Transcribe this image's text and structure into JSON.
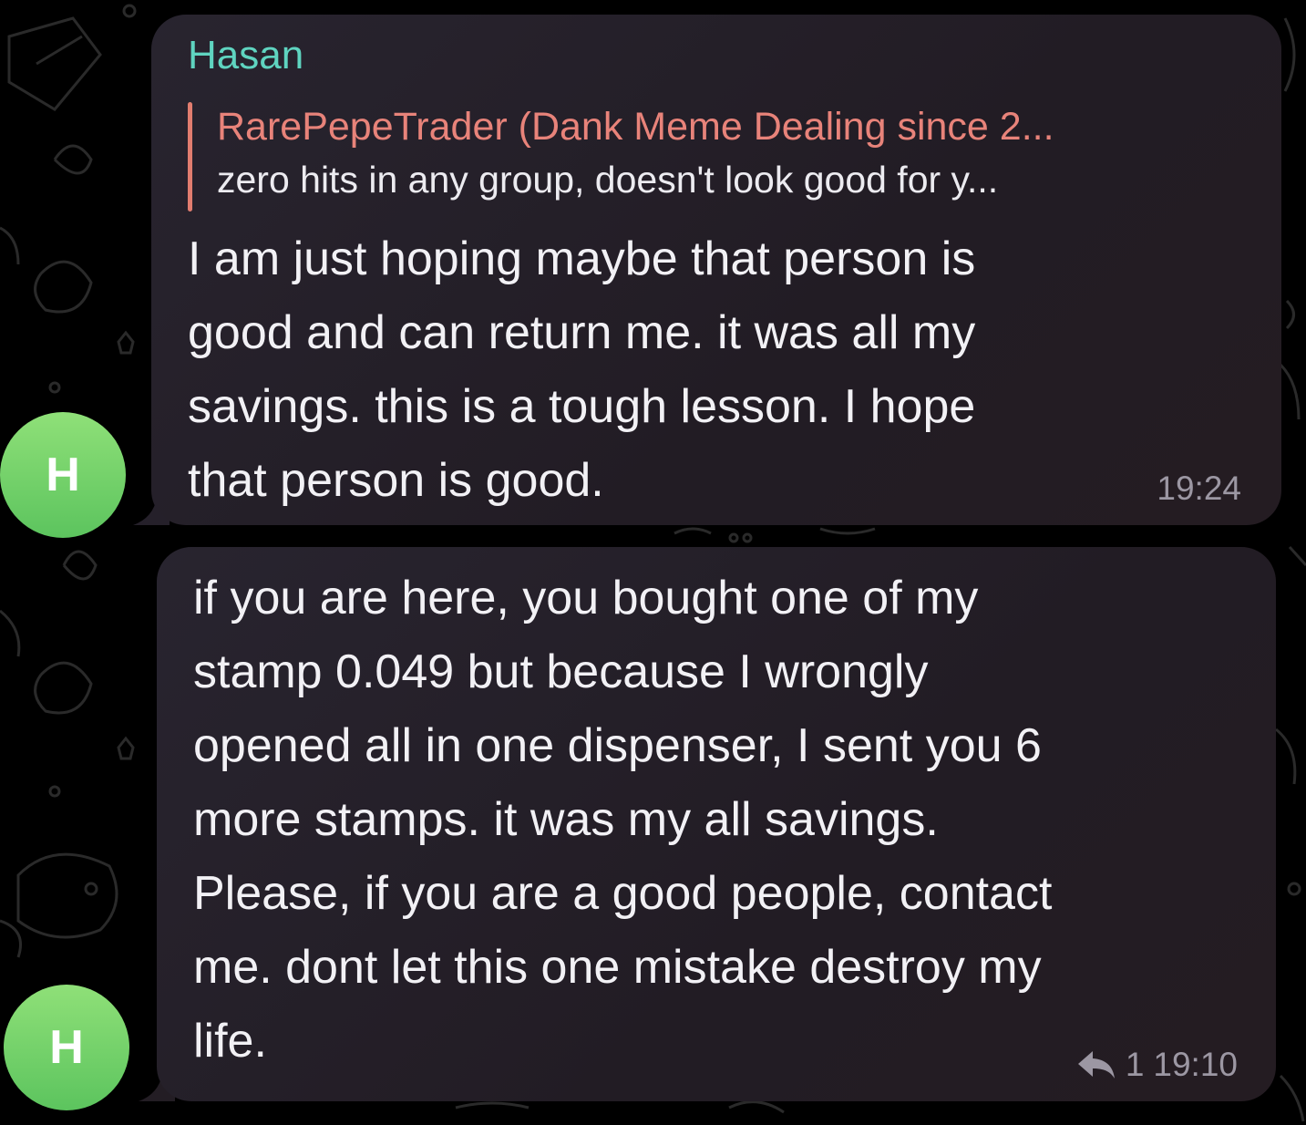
{
  "messages": [
    {
      "sender": "Hasan",
      "reply": {
        "author": "RarePepeTrader (Dank Meme Dealing since 2...",
        "text": "zero hits in any group, doesn't look good for y..."
      },
      "text": "I am just hoping maybe that person is\ngood and can return me. it was all my\nsavings. this is a tough lesson. I hope\nthat person is good.",
      "time": "19:24",
      "avatar_initial": "H"
    },
    {
      "text": "if you are here, you bought one of my\nstamp 0.049 but because I wrongly\nopened all in one dispenser, I sent you 6\nmore stamps. it was my all savings.\nPlease, if you are a good people, contact\nme. dont let this one mistake destroy my\nlife.",
      "replies_count": "1",
      "time": "19:10",
      "avatar_initial": "H"
    }
  ],
  "colors": {
    "sender_name": "#5fd4c0",
    "reply_accent": "#e27d6f",
    "avatar": "#6fd067",
    "bubble": "#26212b",
    "background": "#000000"
  },
  "icons": {
    "reply": "reply-arrow-icon"
  }
}
